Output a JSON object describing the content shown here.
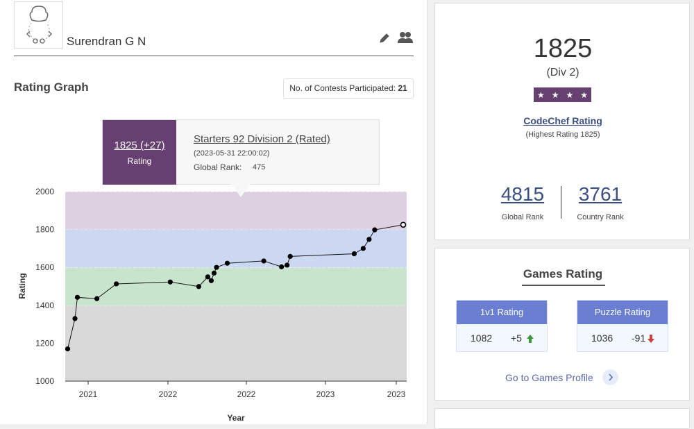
{
  "profile": {
    "name": "Surendran G N",
    "avatar_icon": "chef-avatar-icon",
    "edit_icon": "pencil-icon",
    "team_icon": "users-icon"
  },
  "rating_graph": {
    "title": "Rating Graph",
    "contests_label": "No. of Contests Participated:",
    "contests_count": "21"
  },
  "tooltip": {
    "rating": "1825 (+27)",
    "rating_label": "Rating",
    "contest_name": "Starters 92 Division 2 (Rated)",
    "date": "(2023-05-31 22:00:02)",
    "rank_label": "Global Rank:",
    "rank_value": "475"
  },
  "chart_data": {
    "type": "line",
    "xlabel": "Year",
    "ylabel": "Rating",
    "ylim": [
      1000,
      2000
    ],
    "yticks": [
      1000,
      1200,
      1400,
      1600,
      1800,
      2000
    ],
    "xtick_labels": [
      "2021",
      "2022",
      "2022",
      "2023",
      "2023"
    ],
    "bands": [
      {
        "from": 1000,
        "to": 1400,
        "color": "#d9d9d9"
      },
      {
        "from": 1400,
        "to": 1600,
        "color": "#c8e4cc"
      },
      {
        "from": 1600,
        "to": 1800,
        "color": "#ccd8f2"
      },
      {
        "from": 1800,
        "to": 2000,
        "color": "#ddd0e0"
      }
    ],
    "x_tick_positions_ms": [
      1608076800000,
      1640000000000,
      1671000000000,
      1701000000000,
      1729000000000
    ],
    "series": [
      {
        "points": [
          {
            "date": "2020-10-08",
            "rating": 1170
          },
          {
            "date": "2020-10-29",
            "rating": 1330
          },
          {
            "date": "2020-11-05",
            "rating": 1442
          },
          {
            "date": "2020-12-31",
            "rating": 1435
          },
          {
            "date": "2021-02-25",
            "rating": 1513
          },
          {
            "date": "2021-07-30",
            "rating": 1523
          },
          {
            "date": "2021-10-20",
            "rating": 1499
          },
          {
            "date": "2021-11-15",
            "rating": 1550
          },
          {
            "date": "2021-11-25",
            "rating": 1530
          },
          {
            "date": "2021-12-03",
            "rating": 1570
          },
          {
            "date": "2021-12-10",
            "rating": 1600
          },
          {
            "date": "2022-01-10",
            "rating": 1622
          },
          {
            "date": "2022-04-25",
            "rating": 1634
          },
          {
            "date": "2022-06-15",
            "rating": 1603
          },
          {
            "date": "2022-07-01",
            "rating": 1612
          },
          {
            "date": "2022-07-10",
            "rating": 1658
          },
          {
            "date": "2023-01-10",
            "rating": 1672
          },
          {
            "date": "2023-02-05",
            "rating": 1700
          },
          {
            "date": "2023-02-22",
            "rating": 1748
          },
          {
            "date": "2023-03-10",
            "rating": 1798
          },
          {
            "date": "2023-05-31",
            "rating": 1825
          }
        ]
      }
    ],
    "grid": false,
    "colors": {
      "line": "#111111",
      "point": "#000000"
    }
  },
  "rating_card": {
    "rating": "1825",
    "division": "(Div 2)",
    "stars": [
      "★",
      "★",
      "★",
      "★"
    ],
    "codechef_rating_label": "CodeChef Rating",
    "highest": "(Highest Rating 1825)",
    "global_rank": "4815",
    "global_rank_label": "Global Rank",
    "country_rank": "3761",
    "country_rank_label": "Country Rank",
    "colors": {
      "stars_bg": "#664070",
      "link": "#3a4f80"
    }
  },
  "games": {
    "title": "Games Rating",
    "cards": [
      {
        "title": "1v1 Rating",
        "value": "1082",
        "delta": "+5",
        "dir": "up"
      },
      {
        "title": "Puzzle Rating",
        "value": "1036",
        "delta": "-91",
        "dir": "down"
      }
    ],
    "goto_label": "Go to Games Profile",
    "colors": {
      "card_head": "#6a7fd1",
      "up": "#3a9a3a",
      "down": "#c94040"
    }
  }
}
